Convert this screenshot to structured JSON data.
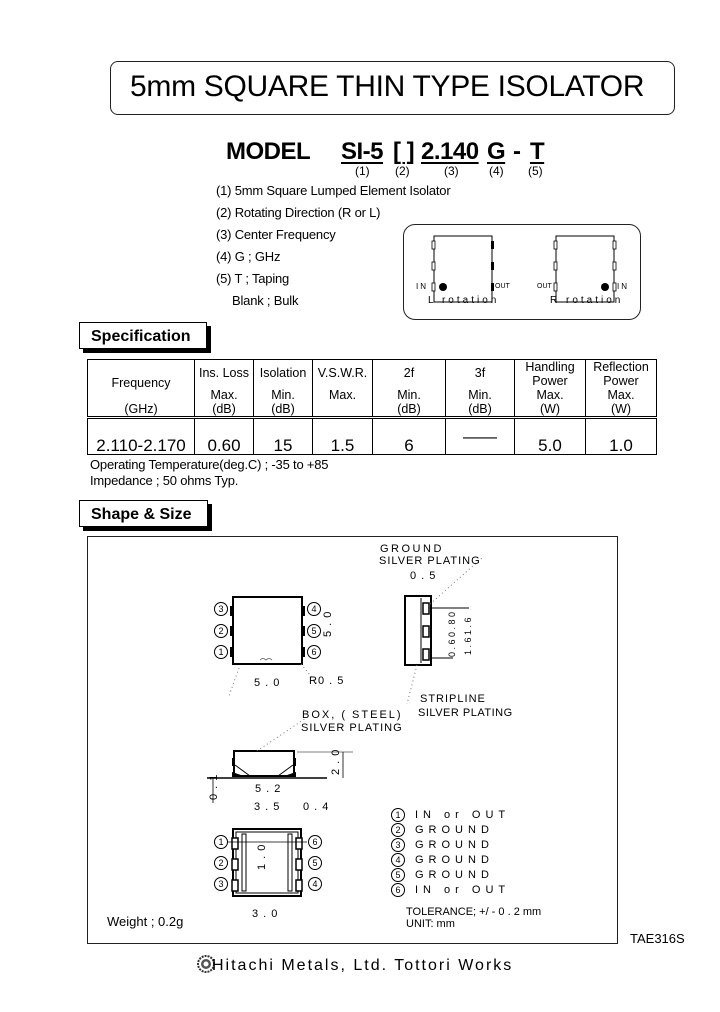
{
  "document": {
    "title": "5mm SQUARE THIN TYPE ISOLATOR",
    "model": {
      "label": "MODEL",
      "parts": [
        {
          "text": "SI-5",
          "index": "(1)"
        },
        {
          "text": "[ ]",
          "index": "(2)"
        },
        {
          "text": "2.140",
          "index": "(3)"
        },
        {
          "text": "G",
          "index": "(4)"
        },
        {
          "text": "T",
          "index": "(5)"
        }
      ],
      "separator": "-"
    },
    "descriptions": [
      "(1) 5mm Square Lumped Element Isolator",
      "(2) Rotating Direction (R or L)",
      "(3) Center Frequency",
      "(4) G ; GHz",
      "(5) T ; Taping",
      "Blank ; Bulk"
    ],
    "rotation_diagram": {
      "left": {
        "in_label": "IN",
        "out_label": "OUT",
        "caption": "L rotation"
      },
      "right": {
        "in_label": "IN",
        "out_label": "OUT",
        "caption": "R rotation"
      }
    },
    "specification": {
      "header": "Specification",
      "columns": [
        {
          "line1": "Frequency",
          "line2": "",
          "line3": "(GHz)"
        },
        {
          "line1": "Ins. Loss",
          "line2": "Max.",
          "line3": "(dB)"
        },
        {
          "line1": "Isolation",
          "line2": "Min.",
          "line3": "(dB)"
        },
        {
          "line1": "V.S.W.R.",
          "line2": "Max.",
          "line3": ""
        },
        {
          "line1": "2f",
          "line2": "Min.",
          "line3": "(dB)"
        },
        {
          "line1": "3f",
          "line2": "Min.",
          "line3": "(dB)"
        },
        {
          "line1": "Handling",
          "line1b": "Power",
          "line2": "Max.",
          "line3": "(W)"
        },
        {
          "line1": "Reflection",
          "line1b": "Power",
          "line2": "Max.",
          "line3": "(W)"
        }
      ],
      "values": [
        "2.110-2.170",
        "0.60",
        "15",
        "1.5",
        "6",
        "——",
        "5.0",
        "1.0"
      ],
      "notes": [
        "Operating Temperature(deg.C) ;  -35  to  +85",
        "Impedance ; 50 ohms Typ."
      ]
    },
    "shape_size": {
      "header": "Shape & Size",
      "labels": {
        "ground": "GROUND",
        "silver_plating_1": "SILVER PLATING",
        "dim_05": "0 . 5",
        "dim_50_h": "5 . 0",
        "dim_50_v": "5 . 0",
        "radius": "R0 . 5",
        "stripline": "STRIPLINE",
        "silver_plating_2": "SILVER PLATING",
        "box_steel": "BOX, ( STEEL)",
        "silver_plating_3": "SILVER PLATING",
        "dim_52": "5 . 2",
        "dim_35": "3 . 5",
        "dim_04": "0 . 4",
        "dim_20": "2 . 0",
        "dim_01": "0 . 1",
        "dim_30": "3 . 0",
        "dim_10": "1 . 0",
        "dim_side_a": "0 . 6  0 . 8  0",
        "dim_side_b": "1 . 6  1 . 6",
        "weight": "Weight ; 0.2g",
        "tolerance": "TOLERANCE; +/ - 0 . 2 mm",
        "unit": "UNIT: mm"
      },
      "pins": [
        {
          "num": "1",
          "function": "IN  or  OUT"
        },
        {
          "num": "2",
          "function": "GROUND"
        },
        {
          "num": "3",
          "function": "GROUND"
        },
        {
          "num": "4",
          "function": "GROUND"
        },
        {
          "num": "5",
          "function": "GROUND"
        },
        {
          "num": "6",
          "function": "IN  or  OUT"
        }
      ]
    },
    "doc_code": "TAE316S",
    "footer": "Hitachi Metals, Ltd. Tottori Works"
  }
}
